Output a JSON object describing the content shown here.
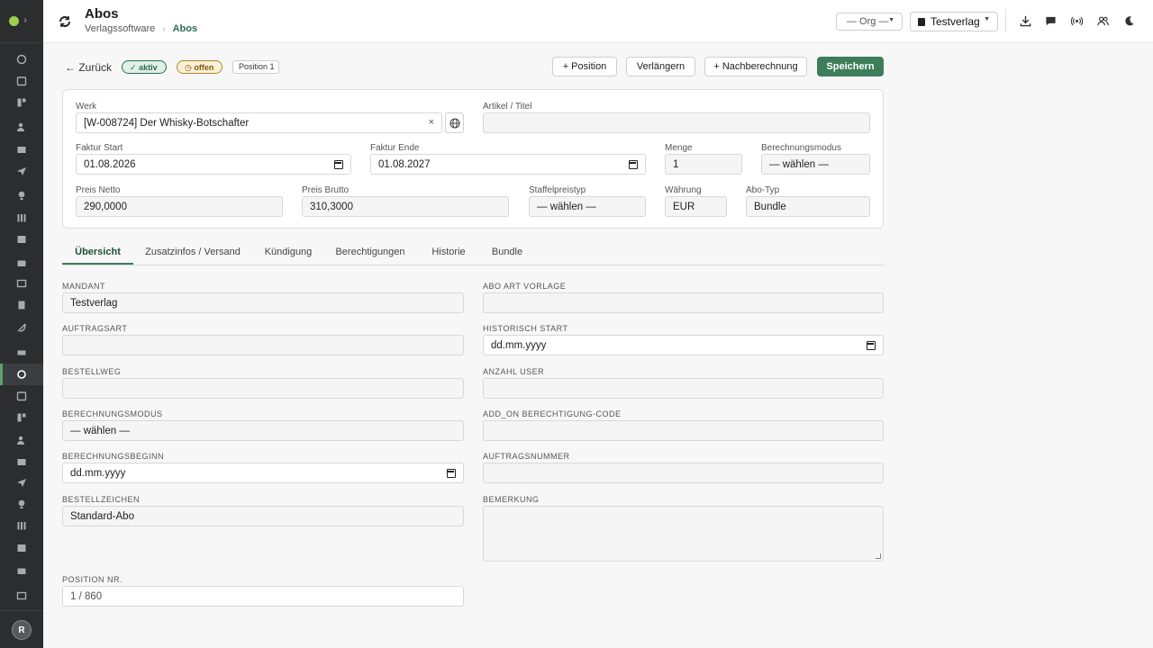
{
  "header": {
    "title": "Abos",
    "breadcrumb": [
      "Verlagssoftware",
      "Abos"
    ],
    "org_select": "— Org —",
    "publisher_select": "Testverlag"
  },
  "user": {
    "initial": "R"
  },
  "sidebar": {
    "icons": [
      "dashboard-icon",
      "calendar-icon",
      "layout-icon",
      "users-icon",
      "stack-icon",
      "send-icon",
      "bulb-icon",
      "library-icon",
      "image-icon",
      "briefcase-icon",
      "newspaper-icon",
      "book-icon",
      "feather-icon",
      "truck-icon",
      "subscription-icon",
      "bag-icon",
      "megaphone-icon",
      "printer-icon",
      "music-icon",
      "document-icon",
      "store-icon",
      "print-job-icon",
      "chart-icon",
      "receipt-icon",
      "shield-icon"
    ],
    "active_index": 14
  },
  "actionbar": {
    "back": "← Zurück",
    "badge_aktiv": "aktiv",
    "badge_offen": "offen",
    "position_tag": "Position 1",
    "add_position": "+ Position",
    "extend": "Verlängern",
    "recalc": "+ Nachberechnung",
    "save": "Speichern"
  },
  "card": {
    "werk_label": "Werk",
    "werk_value": "[W-008724] Der Whisky-Botschafter",
    "artikel_label": "Artikel / Titel",
    "artikel_value": "",
    "faktur_start_label": "Faktur Start",
    "faktur_start_value": "01.08.2026",
    "faktur_ende_label": "Faktur Ende",
    "faktur_ende_value": "01.08.2027",
    "menge_label": "Menge",
    "menge_value": "1",
    "berechnungsmodus_label": "Berechnungsmodus",
    "berechnungsmodus_value": "— wählen —",
    "preis_netto_label": "Preis Netto",
    "preis_netto_value": "290,0000",
    "preis_brutto_label": "Preis Brutto",
    "preis_brutto_value": "310,3000",
    "staffel_label": "Staffelpreistyp",
    "staffel_value": "— wählen —",
    "waehrung_label": "Währung",
    "waehrung_value": "EUR",
    "abotyp_label": "Abo-Typ",
    "abotyp_value": "Bundle"
  },
  "tabs": [
    "Übersicht",
    "Zusatzinfos / Versand",
    "Kündigung",
    "Berechtigungen",
    "Historie",
    "Bundle"
  ],
  "form": {
    "mandant_label": "MANDANT",
    "mandant_value": "Testverlag",
    "aboart_label": "ABO ART VORLAGE",
    "aboart_value": "",
    "auftragsart_label": "AUFTRAGSART",
    "auftragsart_value": "",
    "hist_start_label": "HISTORISCH START",
    "hist_start_value": "dd.mm.yyyy",
    "bestellweg_label": "BESTELLWEG",
    "bestellweg_value": "",
    "anzahl_user_label": "ANZAHL USER",
    "anzahl_user_value": "",
    "berechnungsmodus_label": "BERECHNUNGSMODUS",
    "berechnungsmodus_value": "— wählen —",
    "addon_label": "ADD_ON BERECHTIGUNG-CODE",
    "addon_value": "",
    "berechnungsbeginn_label": "BERECHNUNGSBEGINN",
    "berechnungsbeginn_value": "dd.mm.yyyy",
    "auftragsnummer_label": "AUFTRAGSNUMMER",
    "auftragsnummer_value": "",
    "bestellzeichen_label": "BESTELLZEICHEN",
    "bestellzeichen_value": "Standard-Abo",
    "bemerkung_label": "BEMERKUNG",
    "position_nr_label": "POSITION NR.",
    "position_nr_value": "1 / 860"
  },
  "colors": {
    "accent": "#3d7d5a",
    "sidebar": "#2b2d2f",
    "aktiv": "#2e6e4f",
    "offen": "#b08728"
  }
}
